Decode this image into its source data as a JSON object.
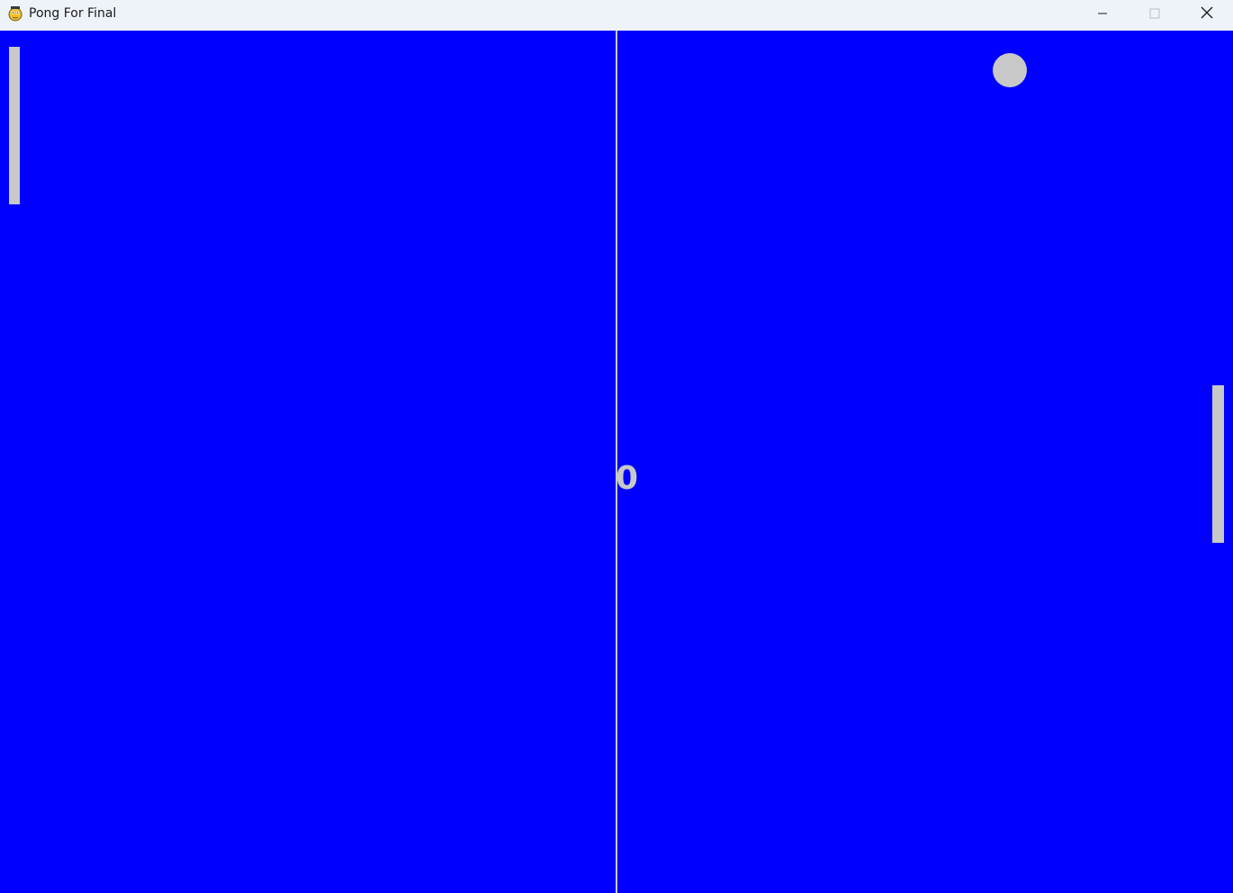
{
  "window": {
    "title": "Pong For Final",
    "app_icon": "pygame-snake-icon",
    "controls": {
      "minimize_icon": "minimize-icon",
      "maximize_icon": "maximize-icon",
      "close_icon": "close-icon"
    }
  },
  "game": {
    "background_color": "#0000ff",
    "foreground_color": "#c8c8c8",
    "score": "0"
  }
}
